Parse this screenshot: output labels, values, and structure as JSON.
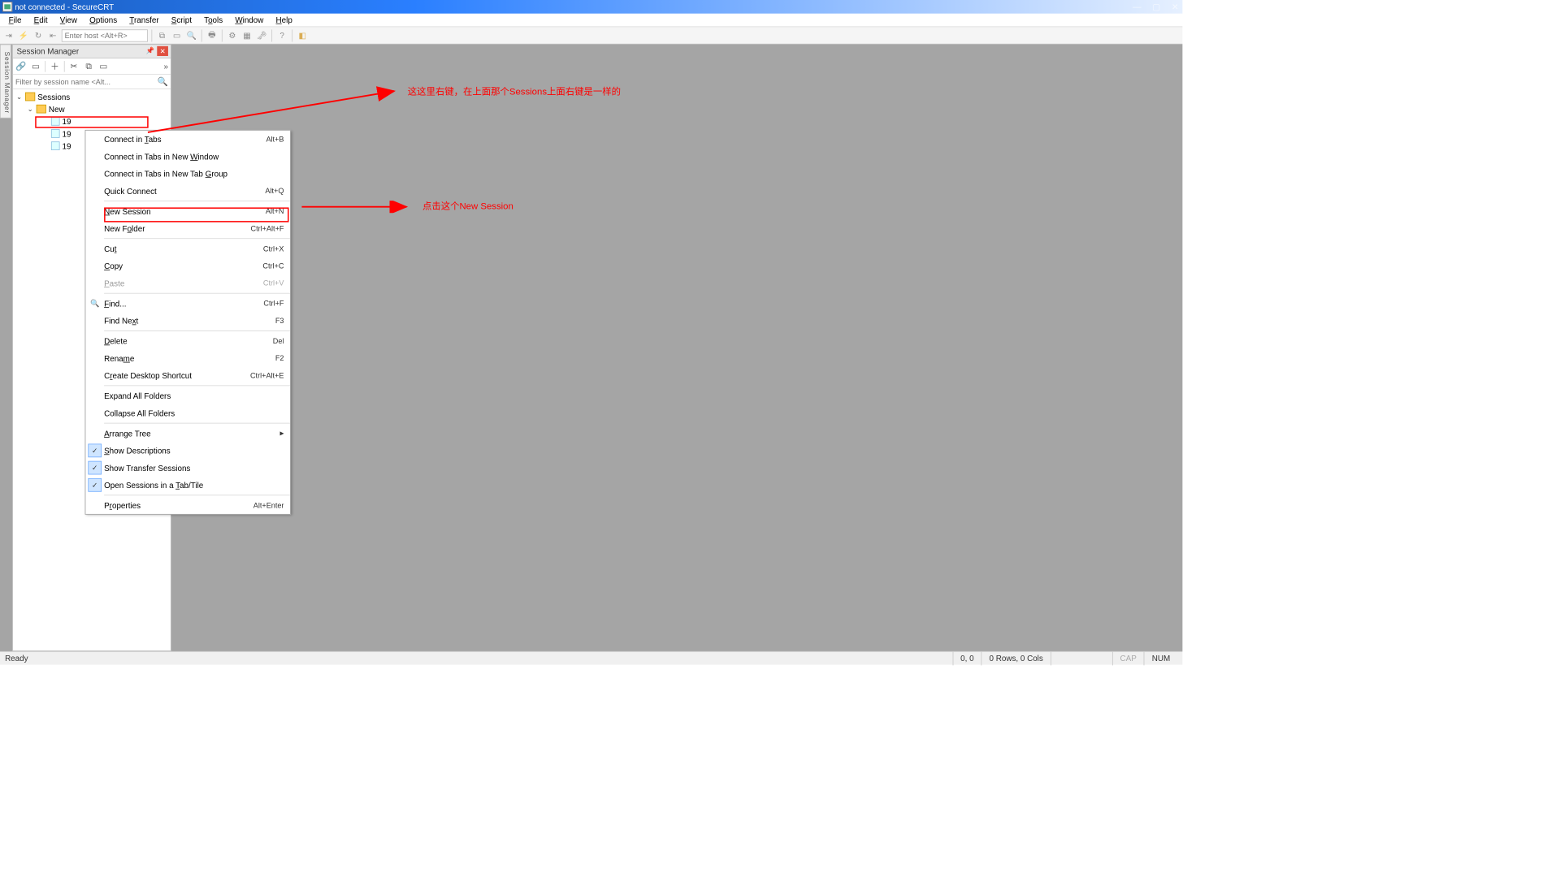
{
  "title": "not connected - SecureCRT",
  "menubar": [
    "File",
    "Edit",
    "View",
    "Options",
    "Transfer",
    "Script",
    "Tools",
    "Window",
    "Help"
  ],
  "toolbar_host_placeholder": "Enter host <Alt+R>",
  "vtab_label": "Session Manager",
  "session_manager": {
    "title": "Session Manager",
    "filter_placeholder": "Filter by session name <Alt...",
    "root": "Sessions",
    "folder_new": "New",
    "items": [
      "19",
      "19",
      "19"
    ]
  },
  "context_menu": {
    "items": [
      {
        "label": "Connect in Tabs",
        "shortcut": "Alt+B",
        "ul": "T"
      },
      {
        "label": "Connect in Tabs in New Window",
        "ul": "W"
      },
      {
        "label": "Connect in Tabs in New Tab Group",
        "ul": "G"
      },
      {
        "label": "Quick Connect",
        "shortcut": "Alt+Q"
      },
      {
        "sep": true
      },
      {
        "label": "New Session",
        "shortcut": "Alt+N",
        "ul": "N",
        "red": true
      },
      {
        "label": "New Folder",
        "shortcut": "Ctrl+Alt+F",
        "ul": "o"
      },
      {
        "sep": true
      },
      {
        "label": "Cut",
        "shortcut": "Ctrl+X",
        "ul": "t"
      },
      {
        "label": "Copy",
        "shortcut": "Ctrl+C",
        "ul": "C"
      },
      {
        "label": "Paste",
        "shortcut": "Ctrl+V",
        "ul": "P",
        "disabled": true
      },
      {
        "sep": true
      },
      {
        "label": "Find...",
        "shortcut": "Ctrl+F",
        "ul": "F",
        "icon": "find"
      },
      {
        "label": "Find Next",
        "shortcut": "F3",
        "ul": "x"
      },
      {
        "sep": true
      },
      {
        "label": "Delete",
        "shortcut": "Del",
        "ul": "D"
      },
      {
        "label": "Rename",
        "shortcut": "F2",
        "ul": "m"
      },
      {
        "label": "Create Desktop Shortcut",
        "shortcut": "Ctrl+Alt+E",
        "ul": "r"
      },
      {
        "sep": true
      },
      {
        "label": "Expand All Folders"
      },
      {
        "label": "Collapse All Folders"
      },
      {
        "sep": true
      },
      {
        "label": "Arrange Tree",
        "ul": "A",
        "submenu": true
      },
      {
        "label": "Show Descriptions",
        "ul": "S",
        "checked": true
      },
      {
        "label": "Show Transfer Sessions",
        "checked": true
      },
      {
        "label": "Open Sessions in a Tab/Tile",
        "ul": "T",
        "checked": true
      },
      {
        "sep": true
      },
      {
        "label": "Properties",
        "shortcut": "Alt+Enter",
        "ul": "r"
      }
    ]
  },
  "annotations": {
    "top": "这这里右键，在上面那个Sessions上面右键是一样的",
    "mid": "点击这个New Session"
  },
  "statusbar": {
    "ready": "Ready",
    "pos": "0, 0",
    "rows": "0 Rows, 0 Cols",
    "cap": "CAP",
    "num": "NUM"
  }
}
